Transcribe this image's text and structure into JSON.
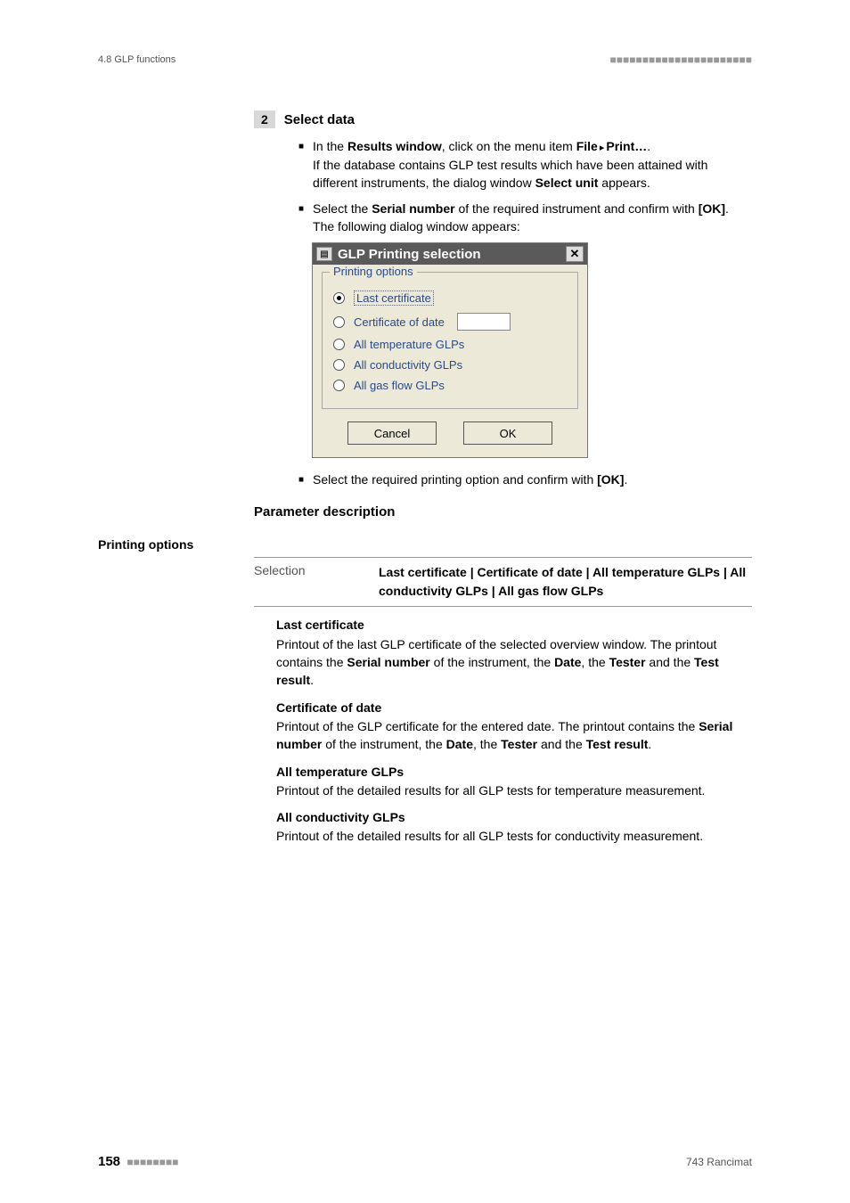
{
  "header": {
    "section": "4.8 GLP functions",
    "dashes": "■■■■■■■■■■■■■■■■■■■■■■"
  },
  "step": {
    "num": "2",
    "title": "Select data"
  },
  "bullets": {
    "b1_pre": "In the ",
    "b1_rw": "Results window",
    "b1_mid1": ", click on the menu item ",
    "b1_file": "File",
    "b1_print": "Print…",
    "b1_end": ".",
    "b1_line2a": "If the database contains GLP test results which have been attained with different instruments, the dialog window ",
    "b1_selunit": "Select unit",
    "b1_line2b": " appears.",
    "b2_pre": "Select the ",
    "b2_sn": "Serial number",
    "b2_mid": " of the required instrument and confirm with ",
    "b2_ok": "[OK]",
    "b2_end": ".",
    "b2_line2": "The following dialog window appears:",
    "b3_pre": "Select the required printing option and confirm with ",
    "b3_ok": "[OK]",
    "b3_end": "."
  },
  "dialog": {
    "title": "GLP Printing selection",
    "group": "Printing options",
    "opt1": "Last certificate",
    "opt2": "Certificate of date",
    "opt3": "All temperature GLPs",
    "opt4": "All conductivity GLPs",
    "opt5": "All gas flow GLPs",
    "cancel": "Cancel",
    "ok": "OK"
  },
  "paramTitle": "Parameter description",
  "sideHeading": "Printing options",
  "selection": {
    "label": "Selection",
    "value": "Last certificate | Certificate of date | All temperature GLPs | All conductivity GLPs | All gas flow GLPs"
  },
  "desc": {
    "d1t": "Last certificate",
    "d1a": "Printout of the last GLP certificate of the selected overview window. The printout contains the ",
    "d1sn": "Serial number",
    "d1b": " of the instrument, the ",
    "d1date": "Date",
    "d1c": ", the ",
    "d1tester": "Tester",
    "d1d": " and the ",
    "d1tr": "Test result",
    "d1e": ".",
    "d2t": "Certificate of date",
    "d2a": "Printout of the GLP certificate for the entered date. The printout contains the ",
    "d2sn": "Serial number",
    "d2b": " of the instrument, the ",
    "d2date": "Date",
    "d2c": ", the ",
    "d2tester": "Tester",
    "d2d": " and the ",
    "d2tr": "Test result",
    "d2e": ".",
    "d3t": "All temperature GLPs",
    "d3": "Printout of the detailed results for all GLP tests for temperature measurement.",
    "d4t": "All conductivity GLPs",
    "d4": "Printout of the detailed results for all GLP tests for conductivity measurement."
  },
  "footer": {
    "page": "158",
    "dashes": "■■■■■■■■",
    "product": "743 Rancimat"
  }
}
